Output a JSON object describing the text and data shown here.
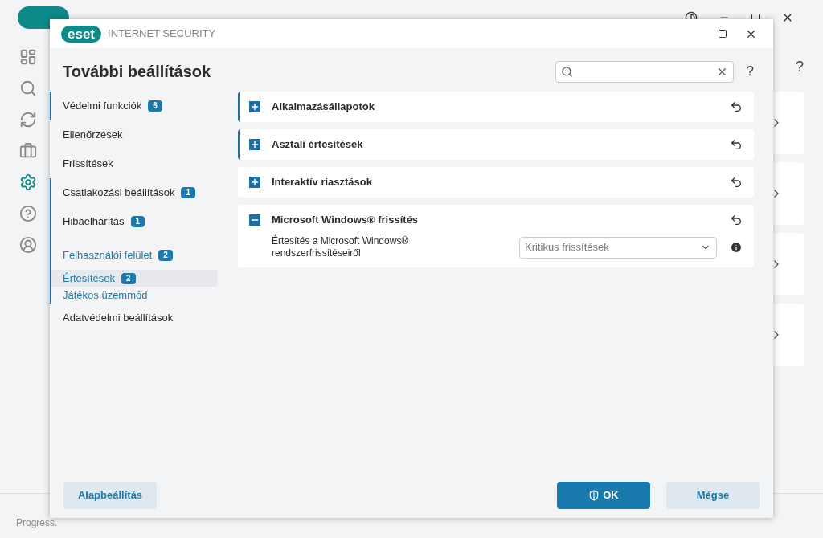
{
  "background": {
    "sidebar": [
      {
        "selected": false
      },
      {
        "selected": false
      },
      {
        "selected": false
      },
      {
        "selected": false
      },
      {
        "selected": true
      },
      {
        "selected": false
      },
      {
        "selected": false
      }
    ],
    "status": "Progress.",
    "help": "?"
  },
  "dialog": {
    "logo": "eset",
    "product": "INTERNET SECURITY",
    "title": "További beállítások",
    "help": "?",
    "nav": [
      {
        "label": "Védelmi funkciók",
        "badge": "6",
        "marked": true,
        "selected": false
      },
      {
        "label": "Ellenőrzések",
        "marked": false,
        "selected": false
      },
      {
        "label": "Frissítések",
        "marked": false,
        "selected": false
      },
      {
        "label": "Csatlakozási beállítások",
        "badge": "1",
        "marked": true,
        "selected": false
      },
      {
        "label": "Hibaelhárítás",
        "badge": "1",
        "marked": true,
        "selected": false
      },
      {
        "label": "Felhasználói felület",
        "badge": "2",
        "marked": true,
        "selected": false,
        "expanded": true,
        "children": [
          {
            "label": "Értesítések",
            "badge": "2",
            "selected": true
          },
          {
            "label": "Játékos üzemmód",
            "selected": false
          }
        ]
      },
      {
        "label": "Adatvédelmi beállítások",
        "marked": false,
        "selected": false
      }
    ],
    "sections": [
      {
        "title": "Alkalmazásállapotok",
        "expanded": false,
        "marked": true
      },
      {
        "title": "Asztali értesítések",
        "expanded": false,
        "marked": true
      },
      {
        "title": "Interaktív riasztások",
        "expanded": false,
        "marked": false
      },
      {
        "title": "Microsoft Windows® frissítés",
        "expanded": true,
        "marked": false,
        "settings": [
          {
            "label": "Értesítés a Microsoft Windows® rendszerfrissítéseiről",
            "value": "Kritikus frissítések"
          }
        ]
      }
    ],
    "buttons": [
      {
        "label": "Alapbeállítás",
        "kind": "secondary"
      },
      {
        "label": "OK",
        "kind": "primary"
      },
      {
        "label": "Mégse",
        "kind": "secondary"
      }
    ]
  }
}
